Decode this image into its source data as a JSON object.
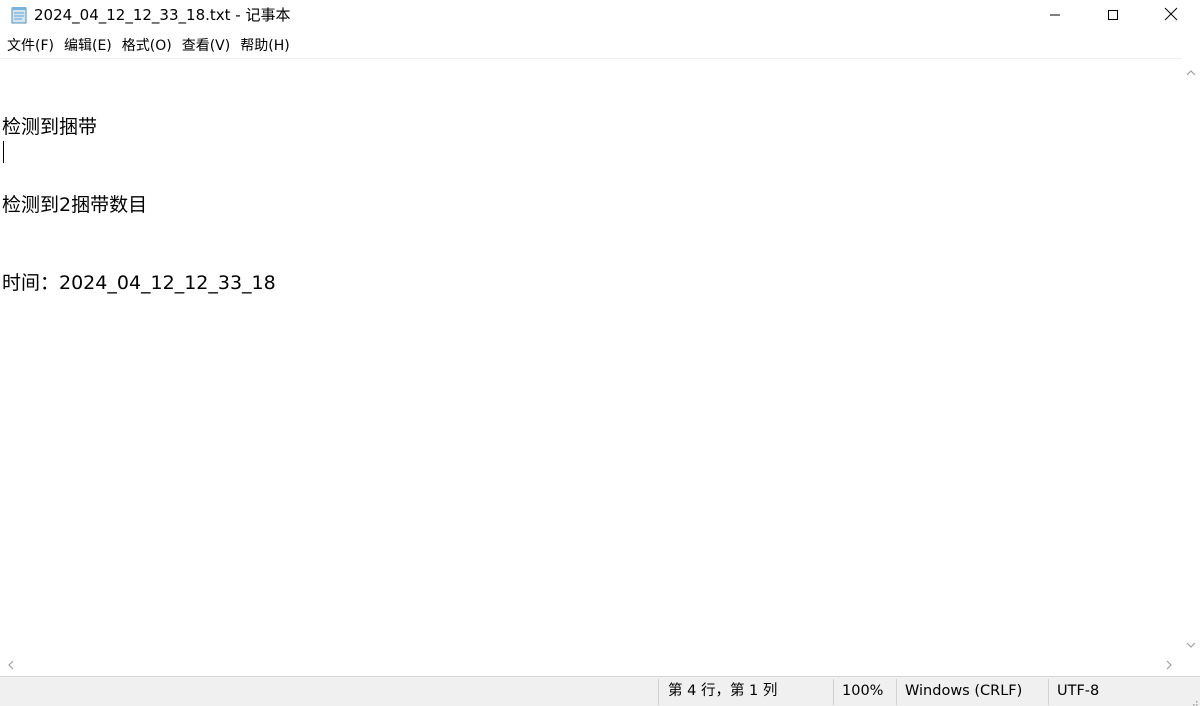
{
  "window": {
    "title": "2024_04_12_12_33_18.txt - 记事本",
    "app_icon": "notepad-icon",
    "controls": {
      "minimize_icon": "minimize-icon",
      "maximize_icon": "maximize-icon",
      "close_icon": "close-icon"
    }
  },
  "menu": {
    "items": [
      {
        "label": "文件(F)"
      },
      {
        "label": "编辑(E)"
      },
      {
        "label": "格式(O)"
      },
      {
        "label": "查看(V)"
      },
      {
        "label": "帮助(H)"
      }
    ]
  },
  "editor": {
    "lines": [
      "检测到捆带",
      "检测到2捆带数目",
      "时间：2024_04_12_12_33_18",
      ""
    ]
  },
  "status": {
    "position": "第 4 行，第 1 列",
    "zoom": "100%",
    "line_ending": "Windows (CRLF)",
    "encoding": "UTF-8"
  },
  "colors": {
    "status_bg": "#f0f0f0",
    "close_hover": "#e81123"
  }
}
